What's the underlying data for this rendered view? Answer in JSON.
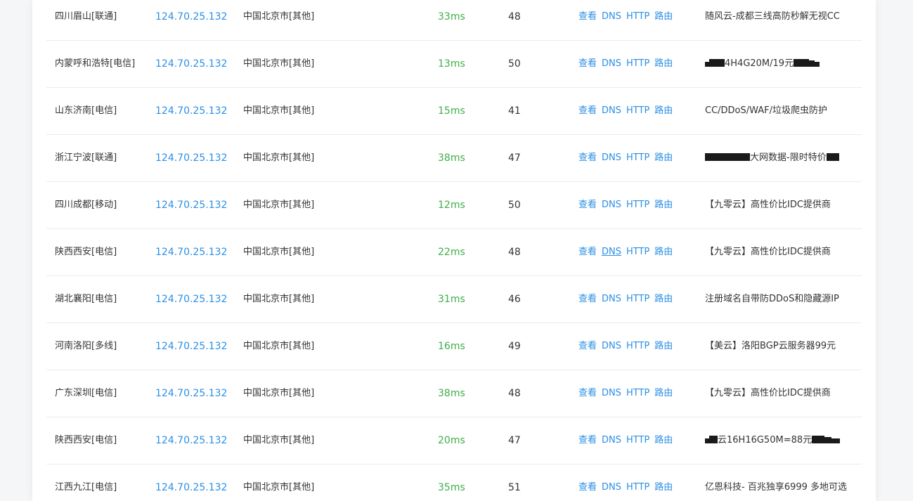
{
  "actions": {
    "view": "查看",
    "dns": "DNS",
    "http": "HTTP",
    "route": "路由"
  },
  "rows": [
    {
      "node": "四川眉山[联通]",
      "ip": "124.70.25.132",
      "location": "中国北京市[其他]",
      "time": "33ms",
      "ttl": "48",
      "ad": "随风云-成都三线高防秒解无视CC"
    },
    {
      "node": "内蒙呼和浩特[电信]",
      "ip": "124.70.25.132",
      "location": "中国北京市[其他]",
      "time": "13ms",
      "ttl": "50",
      "ad_pre": "",
      "ad_mid": "4H4G20M/19元",
      "ad_post": ""
    },
    {
      "node": "山东济南[电信]",
      "ip": "124.70.25.132",
      "location": "中国北京市[其他]",
      "time": "15ms",
      "ttl": "41",
      "ad": "CC/DDoS/WAF/垃圾爬虫防护"
    },
    {
      "node": "浙江宁波[联通]",
      "ip": "124.70.25.132",
      "location": "中国北京市[其他]",
      "time": "38ms",
      "ttl": "47",
      "ad_pre": "",
      "ad_mid": "大网数据-限时特价",
      "ad_post": ""
    },
    {
      "node": "四川成都[移动]",
      "ip": "124.70.25.132",
      "location": "中国北京市[其他]",
      "time": "12ms",
      "ttl": "50",
      "ad": "【九零云】高性价比IDC提供商"
    },
    {
      "node": "陕西西安[电信]",
      "ip": "124.70.25.132",
      "location": "中国北京市[其他]",
      "time": "22ms",
      "ttl": "48",
      "ad": "【九零云】高性价比IDC提供商"
    },
    {
      "node": "湖北襄阳[电信]",
      "ip": "124.70.25.132",
      "location": "中国北京市[其他]",
      "time": "31ms",
      "ttl": "46",
      "ad": "注册域名自带防DDoS和隐藏源IP"
    },
    {
      "node": "河南洛阳[多线]",
      "ip": "124.70.25.132",
      "location": "中国北京市[其他]",
      "time": "16ms",
      "ttl": "49",
      "ad": "【美云】洛阳BGP云服务器99元"
    },
    {
      "node": "广东深圳[电信]",
      "ip": "124.70.25.132",
      "location": "中国北京市[其他]",
      "time": "38ms",
      "ttl": "48",
      "ad": "【九零云】高性价比IDC提供商"
    },
    {
      "node": "陕西西安[电信]",
      "ip": "124.70.25.132",
      "location": "中国北京市[其他]",
      "time": "20ms",
      "ttl": "47",
      "ad_pre": "",
      "ad_mid": "云16H16G50M=88元",
      "ad_post": ""
    },
    {
      "node": "江西九江[电信]",
      "ip": "124.70.25.132",
      "location": "中国北京市[其他]",
      "time": "35ms",
      "ttl": "51",
      "ad": "亿恩科技- 百兆独享6999 多地可选"
    }
  ],
  "colors": {
    "link": "#2b8fe5",
    "time": "#3fae49",
    "text": "#333333",
    "divider": "#e9ebef"
  }
}
